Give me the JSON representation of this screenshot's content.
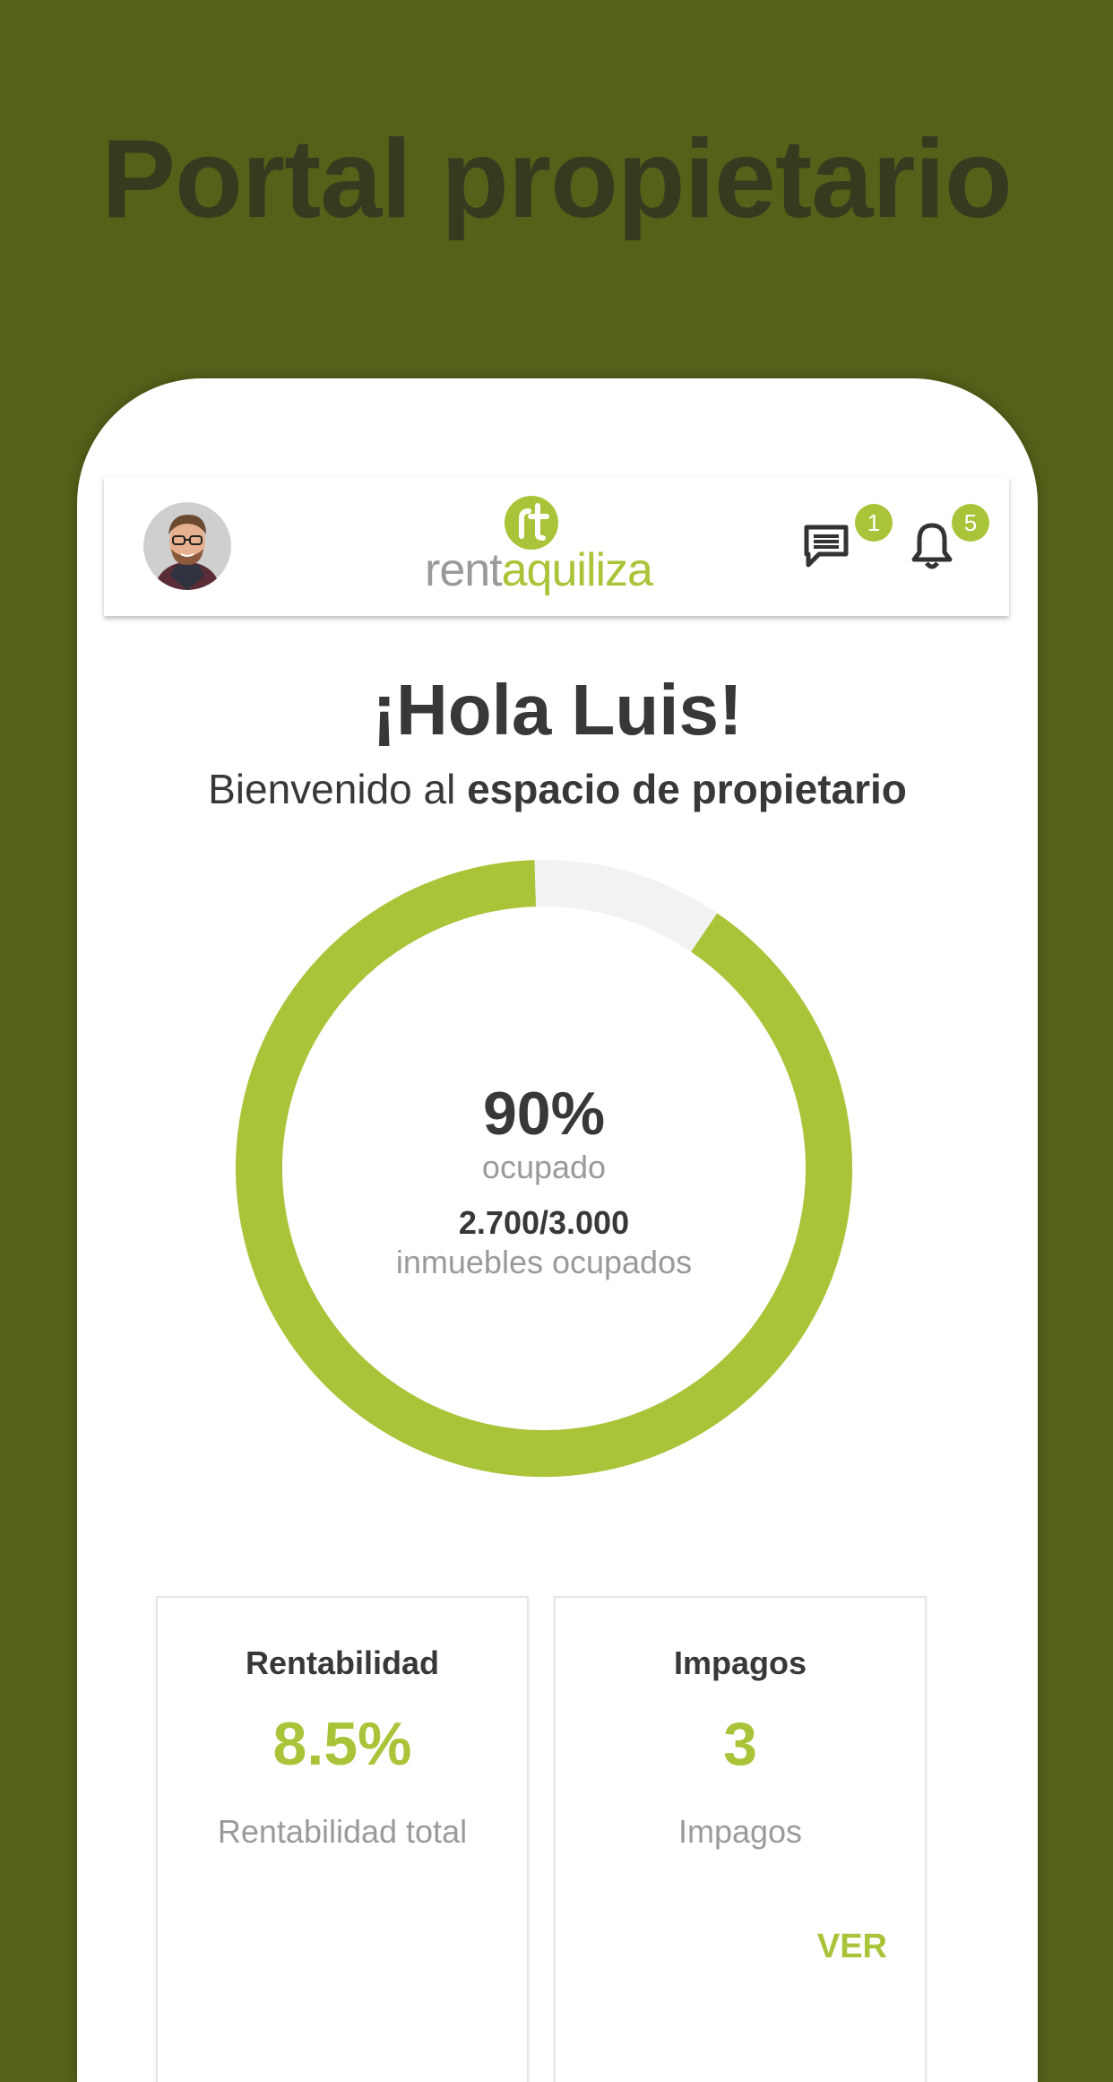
{
  "promo": {
    "title": "Portal propietario"
  },
  "header": {
    "logo_part1": "rent",
    "logo_part2": "aquiliza",
    "messages_badge": "1",
    "notifications_badge": "5",
    "icons": [
      "avatar",
      "rt-logo-mark",
      "chat-icon",
      "bell-icon"
    ]
  },
  "greeting": {
    "title": "¡Hola Luis!",
    "welcome_prefix": "Bienvenido al ",
    "welcome_bold": "espacio de propietario"
  },
  "occupancy": {
    "percent_label": "90%",
    "percent_caption": "ocupado",
    "count": "2.700/3.000",
    "count_caption": "inmuebles ocupados",
    "occupied_fraction": 0.9
  },
  "cards": {
    "rentabilidad": {
      "title": "Rentabilidad",
      "value": "8.5%",
      "subtitle": "Rentabilidad total"
    },
    "impagos": {
      "title": "Impagos",
      "value": "3",
      "subtitle": "Impagos",
      "link": "VER"
    }
  },
  "colors": {
    "background": "#546119",
    "accent": "#a9c438",
    "text_dark": "#383838",
    "text_muted": "#9a9a9a",
    "donut_track": "#f2f2f2"
  }
}
